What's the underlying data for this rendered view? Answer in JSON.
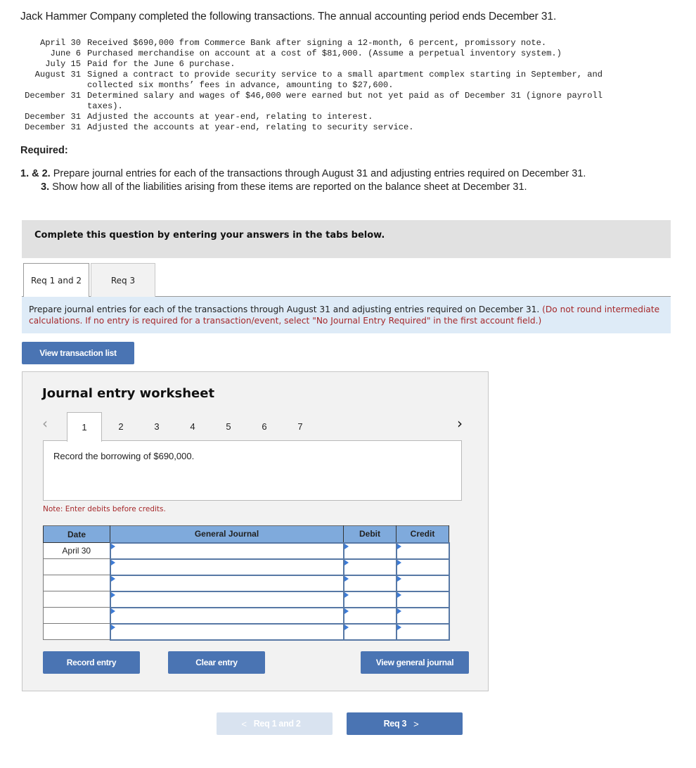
{
  "problem": {
    "intro": "Jack Hammer Company completed the following transactions. The annual accounting period ends December 31.",
    "transactions": [
      {
        "date": "April 30",
        "description": "Received $690,000 from Commerce Bank after signing a 12-month, 6 percent, promissory note."
      },
      {
        "date": "June 6",
        "description": "Purchased merchandise on account at a cost of $81,000. (Assume a perpetual inventory system.)"
      },
      {
        "date": "July 15",
        "description": "Paid for the June 6 purchase."
      },
      {
        "date": "August 31",
        "description": "Signed a contract to provide security service to a small apartment complex starting in September, and collected six months’ fees in advance, amounting to $27,600."
      },
      {
        "date": "December 31",
        "description": "Determined salary and wages of $46,000 were earned but not yet paid as of December 31 (ignore payroll taxes)."
      },
      {
        "date": "December 31",
        "description": "Adjusted the accounts at year-end, relating to interest."
      },
      {
        "date": "December 31",
        "description": "Adjusted the accounts at year-end, relating to security service."
      }
    ],
    "required_label": "Required:",
    "requirements": [
      {
        "number": "1. & 2.",
        "text": " Prepare journal entries for each of the transactions through August 31 and adjusting entries required on December 31."
      },
      {
        "number": "3.",
        "text": " Show how all of the liabilities arising from these items are reported on the balance sheet at December 31."
      }
    ]
  },
  "banner": {
    "text": "Complete this question by entering your answers in the tabs below."
  },
  "tabs": [
    {
      "label": "Req 1 and 2",
      "active": true
    },
    {
      "label": "Req 3",
      "active": false
    }
  ],
  "instructions": {
    "text": "Prepare journal entries for each of the transactions through August 31 and adjusting entries required on December 31. ",
    "red_text": "(Do not round intermediate calculations. If no entry is required for a transaction/event, select \"No Journal Entry Required\" in the first account field.)"
  },
  "view_transaction_list_label": "View transaction list",
  "worksheet": {
    "title": "Journal entry worksheet",
    "pages": [
      "1",
      "2",
      "3",
      "4",
      "5",
      "6",
      "7"
    ],
    "active_page": "1",
    "prev_icon": "‹",
    "next_icon": "›",
    "description": "Record the borrowing of $690,000.",
    "note": "Note: Enter debits before credits.",
    "table": {
      "headers": {
        "date": "Date",
        "journal": "General Journal",
        "debit": "Debit",
        "credit": "Credit"
      },
      "rows": [
        {
          "date": "April 30",
          "account": "",
          "debit": "",
          "credit": ""
        },
        {
          "date": "",
          "account": "",
          "debit": "",
          "credit": ""
        },
        {
          "date": "",
          "account": "",
          "debit": "",
          "credit": ""
        },
        {
          "date": "",
          "account": "",
          "debit": "",
          "credit": ""
        },
        {
          "date": "",
          "account": "",
          "debit": "",
          "credit": ""
        },
        {
          "date": "",
          "account": "",
          "debit": "",
          "credit": ""
        }
      ]
    },
    "buttons": {
      "record": "Record entry",
      "clear": "Clear entry",
      "view_journal": "View general journal"
    }
  },
  "navigation": {
    "prev_label": "Req 1 and 2",
    "next_label": "Req 3",
    "prev_icon": "<",
    "next_icon": ">"
  },
  "colors": {
    "button_blue": "#4a74b3",
    "table_header_blue": "#7faadc",
    "instruction_bg": "#deebf7",
    "warning_red": "#a5282a"
  }
}
